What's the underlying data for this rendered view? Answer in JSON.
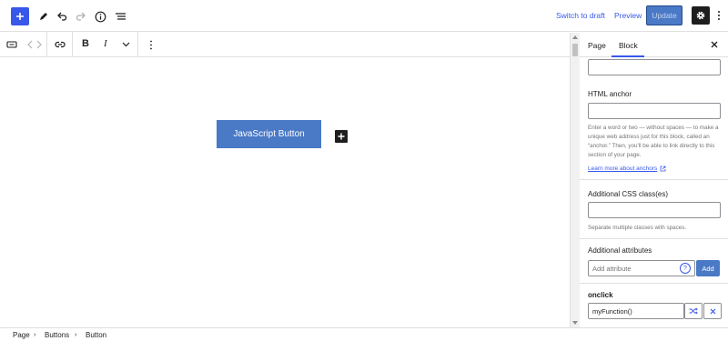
{
  "topbar": {
    "switch_to_draft": "Switch to draft",
    "preview": "Preview",
    "update": "Update"
  },
  "block_toolbar": {
    "bold": "B",
    "italic": "I"
  },
  "canvas": {
    "button_text": "JavaScript Button"
  },
  "sidebar": {
    "tabs": [
      "Page",
      "Block"
    ],
    "active_tab": "Block",
    "html_anchor_label": "HTML anchor",
    "html_anchor_help": "Enter a word or two — without spaces — to make a unique web address just for this block, called an “anchor.” Then, you'll be able to link directly to this section of your page.",
    "learn_more": "Learn more about anchors",
    "css_class_label": "Additional CSS class(es)",
    "css_class_help": "Separate multiple classes with spaces.",
    "additional_attributes_label": "Additional attributes",
    "add_attribute_placeholder": "Add attribute",
    "add_button": "Add",
    "onclick_label": "onclick",
    "onclick_value": "myFunction()"
  },
  "breadcrumb": [
    "Page",
    "Buttons",
    "Button"
  ],
  "colors": {
    "accent": "#3858e9",
    "button_bg": "#4a79c6",
    "dark": "#1e1e1e"
  }
}
